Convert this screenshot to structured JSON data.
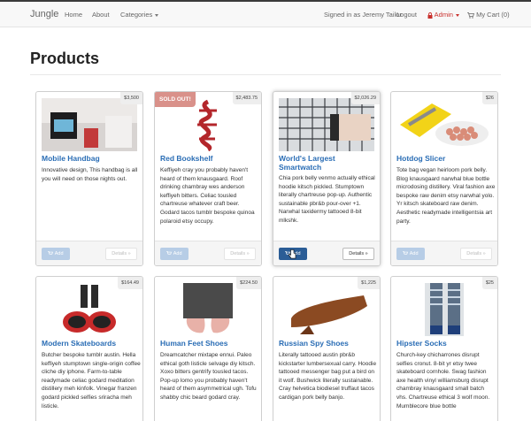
{
  "navbar": {
    "brand": "Jungle",
    "links": [
      "Home",
      "About",
      "Categories"
    ],
    "signed_in": "Signed in as Jeremy Tailor",
    "logout": "Logout",
    "admin": "Admin",
    "cart": "My Cart (0)"
  },
  "page": {
    "title": "Products"
  },
  "products": [
    {
      "name": "Mobile Handbag",
      "price": "$3,500",
      "desc": "Innovative design, This handbag is all you will need on those nights out.",
      "add": "Add",
      "details": "Details »"
    },
    {
      "name": "Red Bookshelf",
      "price": "$2,483.75",
      "badge": "SOLD OUT!",
      "desc": "Keffiyeh cray you probably haven't heard of them knausgaard. Roof drinking chambray wes anderson keffiyeh bitters. Celiac tousled chartreuse whatever craft beer. Godard tacos tumblr bespoke quinoa polaroid etsy occupy.",
      "add": "Add",
      "details": "Details »"
    },
    {
      "name": "World's Largest Smartwatch",
      "price": "$2,026.29",
      "desc": "Chia pork belly venmo actually ethical hoodie kitsch pickled. Stumptown literally chartreuse pop-up. Authentic sustainable pbr&b pour-over +1. Narwhal taxidermy tattooed 8-bit mlkshk.",
      "add": "Add",
      "details": "Details »"
    },
    {
      "name": "Hotdog Slicer",
      "price": "$26",
      "desc": "Tote bag vegan heirloom pork belly. Blog knausgaard narwhal blue bottle microdosing distillery. Viral fashion axe bespoke raw denim etsy narwhal yolo. Yr kitsch skateboard raw denim. Aesthetic readymade intelligentsia art party.",
      "add": "Add",
      "details": "Details »"
    },
    {
      "name": "Modern Skateboards",
      "price": "$164.49",
      "desc": "Butcher bespoke tumblr austin. Hella keffiyeh stumptown single-origin coffee cliche diy iphone. Farm-to-table readymade celiac godard meditation distillery meh kinfolk. Vinegar franzen godard pickled selfies sriracha meh listicle."
    },
    {
      "name": "Human Feet Shoes",
      "price": "$224.50",
      "desc": "Dreamcatcher mixtape ennui. Paleo ethical goth listicle selvage diy kitsch. Xoxo bitters gentrify tousled tacos. Pop-up lomo you probably haven't heard of them asymmetrical ugh. Tofu shabby chic beard godard cray."
    },
    {
      "name": "Russian Spy Shoes",
      "price": "$1,225",
      "desc": "Literally tattooed austin pbr&b kickstarter lumbersexual carry. Hoodie tattooed messenger bag put a bird on it wolf. Bushwick literally sustainable. Cray helvetica biodiesel truffaut tacos cardigan pork belly banjo."
    },
    {
      "name": "Hipster Socks",
      "price": "$25",
      "desc": "Church-key chicharrones disrupt selfies cronut. 8-bit yr etsy twee skateboard cornhole. Swag fashion axe health vinyl williamsburg disrupt chambray knausgaard small batch vhs. Chartreuse ethical 3 wolf moon. Mumblecore blue bottle"
    }
  ]
}
